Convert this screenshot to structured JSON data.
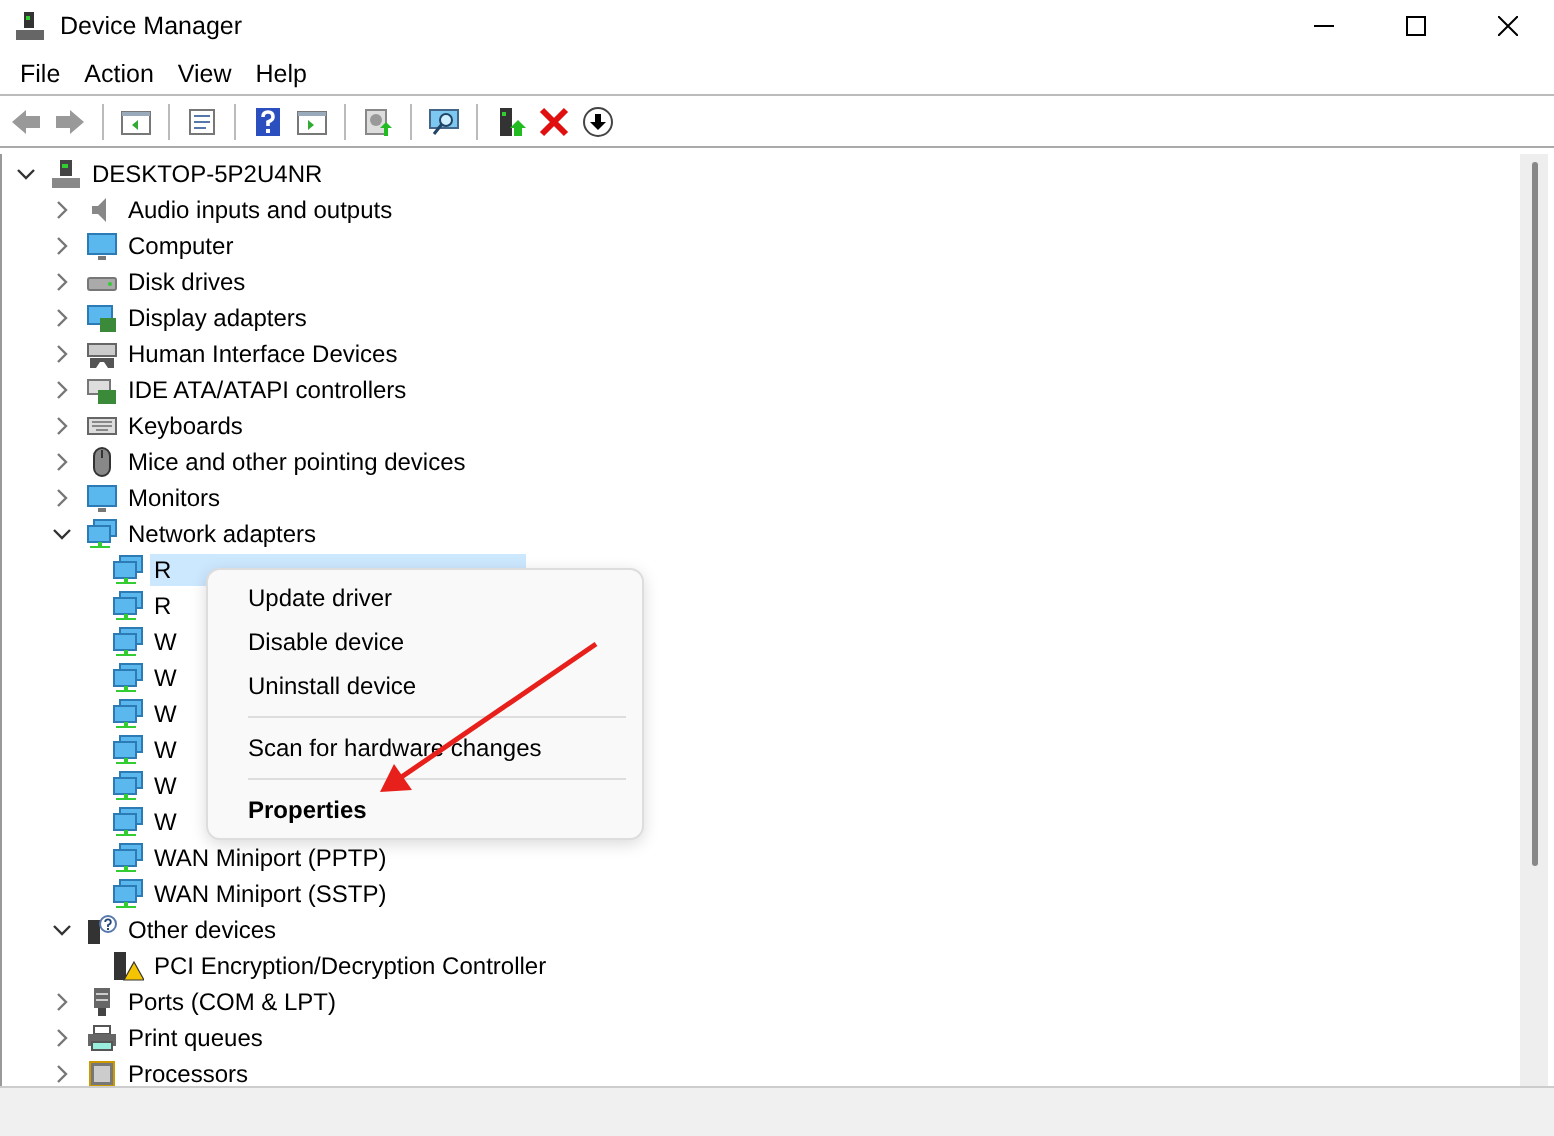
{
  "window": {
    "title": "Device Manager"
  },
  "menu_bar": [
    "File",
    "Action",
    "View",
    "Help"
  ],
  "tree": {
    "label": "DESKTOP-5P2U4NR",
    "expanded": true,
    "children": [
      {
        "label": "Audio inputs and outputs",
        "expanded": false
      },
      {
        "label": "Computer",
        "expanded": false
      },
      {
        "label": "Disk drives",
        "expanded": false
      },
      {
        "label": "Display adapters",
        "expanded": false
      },
      {
        "label": "Human Interface Devices",
        "expanded": false
      },
      {
        "label": "IDE ATA/ATAPI controllers",
        "expanded": false
      },
      {
        "label": "Keyboards",
        "expanded": false
      },
      {
        "label": "Mice and other pointing devices",
        "expanded": false
      },
      {
        "label": "Monitors",
        "expanded": false
      },
      {
        "label": "Network adapters",
        "expanded": true,
        "children": [
          {
            "label": "R",
            "selected": true
          },
          {
            "label": "R",
            "selected": false
          },
          {
            "label": "W",
            "selected": false
          },
          {
            "label": "W",
            "selected": false
          },
          {
            "label": "W",
            "selected": false
          },
          {
            "label": "W",
            "selected": false
          },
          {
            "label": "W",
            "selected": false
          },
          {
            "label": "W",
            "selected": false
          },
          {
            "label": "WAN Miniport (PPTP)",
            "selected": false
          },
          {
            "label": "WAN Miniport (SSTP)",
            "selected": false
          }
        ]
      },
      {
        "label": "Other devices",
        "expanded": true,
        "children": [
          {
            "label": "PCI Encryption/Decryption Controller",
            "selected": false
          }
        ]
      },
      {
        "label": "Ports (COM & LPT)",
        "expanded": false
      },
      {
        "label": "Print queues",
        "expanded": false
      },
      {
        "label": "Processors",
        "expanded": false
      }
    ]
  },
  "context_menu": [
    {
      "kind": "item",
      "label": "Update driver",
      "default": false
    },
    {
      "kind": "item",
      "label": "Disable device",
      "default": false
    },
    {
      "kind": "item",
      "label": "Uninstall device",
      "default": false
    },
    {
      "kind": "separator"
    },
    {
      "kind": "item",
      "label": "Scan for hardware changes",
      "default": false
    },
    {
      "kind": "separator"
    },
    {
      "kind": "item",
      "label": "Properties",
      "default": true
    }
  ]
}
